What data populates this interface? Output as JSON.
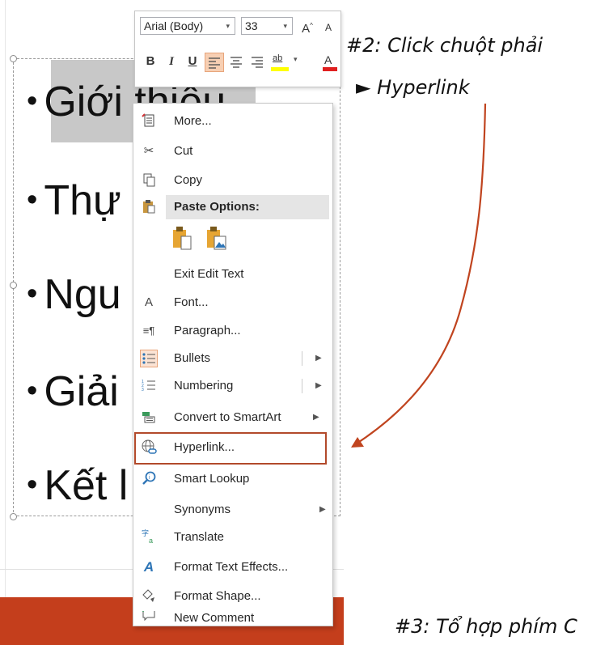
{
  "slide": {
    "bullets": [
      "Giới thiệu",
      "Thự",
      "Ngu",
      "Giải",
      "Kết l"
    ],
    "bullet_char": "•",
    "accent_bar_color": "#c43e1c"
  },
  "mini_toolbar": {
    "font_name": "Arial (Body)",
    "font_size": "33",
    "grow_font": "A",
    "shrink_font": "A",
    "bold": "B",
    "italic": "I",
    "underline": "U",
    "highlight": "ab",
    "font_color": "A"
  },
  "context_menu": {
    "items": [
      {
        "label": "More...",
        "icon": "add-comment-icon"
      },
      {
        "label": "Cut",
        "icon": "scissors-icon"
      },
      {
        "label": "Copy",
        "icon": "copy-icon"
      },
      {
        "label": "Paste Options:",
        "icon": "paste-icon"
      },
      {
        "label": "Exit Edit Text",
        "icon": ""
      },
      {
        "label": "Font...",
        "icon": "font-icon"
      },
      {
        "label": "Paragraph...",
        "icon": "paragraph-icon"
      },
      {
        "label": "Bullets",
        "icon": "bullets-icon",
        "submenu": true
      },
      {
        "label": "Numbering",
        "icon": "numbering-icon",
        "submenu": true
      },
      {
        "label": "Convert to SmartArt",
        "icon": "smartart-icon",
        "submenu": true
      },
      {
        "label": "Hyperlink...",
        "icon": "globe-link-icon"
      },
      {
        "label": "Smart Lookup",
        "icon": "smart-lookup-icon"
      },
      {
        "label": "Synonyms",
        "icon": "",
        "submenu": true
      },
      {
        "label": "Translate",
        "icon": "translate-icon"
      },
      {
        "label": "Format Text Effects...",
        "icon": "text-effects-icon"
      },
      {
        "label": "Format Shape...",
        "icon": "format-shape-icon"
      },
      {
        "label": "New Comment",
        "icon": "new-comment-icon"
      }
    ]
  },
  "annotations": {
    "step2_line1": "#2: Click chuột phải",
    "step2_line2": "► Hyperlink",
    "step3": "#3: Tổ hợp phím C",
    "arrow_color": "#c0441f"
  }
}
